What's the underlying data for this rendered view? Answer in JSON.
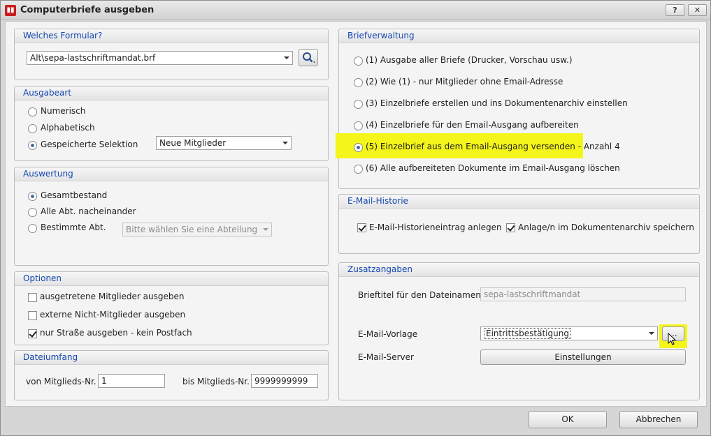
{
  "window": {
    "title": "Computerbriefe ausgeben",
    "help_label": "?",
    "close_label": "✕"
  },
  "formular": {
    "header": "Welches Formular?",
    "value": "Alt\\sepa-lastschriftmandat.brf"
  },
  "ausgabeart": {
    "header": "Ausgabeart",
    "options": [
      "Numerisch",
      "Alphabetisch",
      "Gespeicherte Selektion"
    ],
    "selection_combo": "Neue Mitglieder"
  },
  "auswertung": {
    "header": "Auswertung",
    "options": [
      "Gesamtbestand",
      "Alle Abt. nacheinander",
      "Bestimmte Abt."
    ],
    "abteilung_placeholder": "Bitte wählen Sie eine Abteilung"
  },
  "optionen": {
    "header": "Optionen",
    "items": [
      "ausgetretene Mitglieder ausgeben",
      "externe Nicht-Mitglieder ausgeben",
      "nur Straße ausgeben - kein Postfach"
    ]
  },
  "dateiumfang": {
    "header": "Dateiumfang",
    "from_label": "von Mitglieds-Nr.",
    "from_value": "1",
    "to_label": "bis Mitglieds-Nr.",
    "to_value": "9999999999"
  },
  "briefverwaltung": {
    "header": "Briefverwaltung",
    "options": [
      "(1) Ausgabe aller Briefe (Drucker, Vorschau usw.)",
      "(2) Wie (1) - nur Mitglieder ohne Email-Adresse",
      "(3) Einzelbriefe erstellen und ins Dokumentenarchiv einstellen",
      "(4) Einzelbriefe für den Email-Ausgang aufbereiten",
      "(5) Einzelbrief aus dem Email-Ausgang versenden - Anzahl 4",
      "(6) Alle aufbereiteten Dokumente im Email-Ausgang löschen"
    ]
  },
  "historie": {
    "header": "E-Mail-Historie",
    "item1": "E-Mail-Historieneintrag anlegen",
    "item2": "Anlage/n im Dokumentenarchiv speichern"
  },
  "zusatz": {
    "header": "Zusatzangaben",
    "brieftitel_label": "Brieftitel für den Dateinamen",
    "brieftitel_value": "sepa-lastschriftmandat",
    "vorlage_label": "E-Mail-Vorlage",
    "vorlage_value": "Eintrittsbestätigung",
    "ellipsis_label": "...",
    "server_label": "E-Mail-Server",
    "server_button": "Einstellungen"
  },
  "footer": {
    "ok": "OK",
    "cancel": "Abbrechen"
  },
  "colors": {
    "group_header_text": "#1447b0",
    "highlight": "#f4f51a"
  }
}
